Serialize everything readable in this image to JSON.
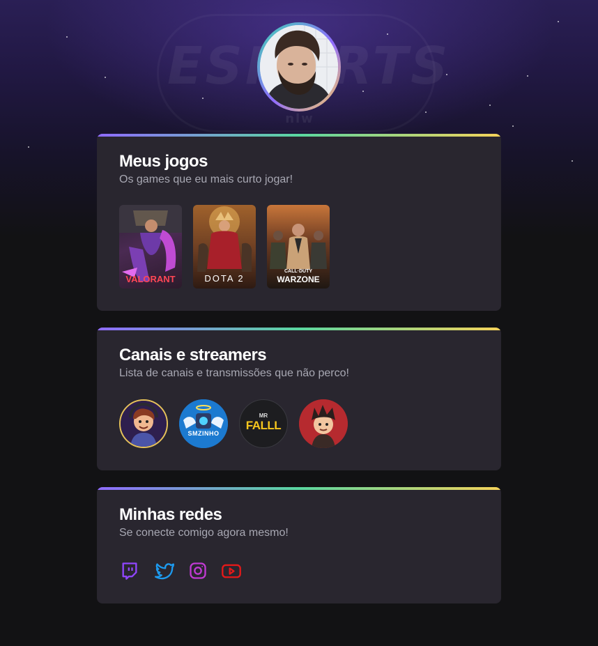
{
  "hero": {
    "watermark": "ESPORTS",
    "watermark_sub": "nlw"
  },
  "profile": {
    "avatar_icon": "user-avatar"
  },
  "games": {
    "title": "Meus jogos",
    "subtitle": "Os games que eu mais curto jogar!",
    "items": [
      {
        "label": "VALORANT"
      },
      {
        "label": "DOTA 2"
      },
      {
        "label_top": "CALL·DUTY",
        "label": "WARZONE"
      }
    ]
  },
  "channels": {
    "title": "Canais e streamers",
    "subtitle": "Lista de canais e transmissões que não perco!",
    "items": [
      {
        "label": ""
      },
      {
        "label": "SMZINHO"
      },
      {
        "label_top": "MR",
        "label": "FALLL"
      },
      {
        "label": ""
      }
    ]
  },
  "socials": {
    "title": "Minhas redes",
    "subtitle": "Se conecte comigo agora mesmo!",
    "items": [
      {
        "icon": "twitch-icon",
        "color": "#9146ff"
      },
      {
        "icon": "twitter-icon",
        "color": "#1d9bf0"
      },
      {
        "icon": "instagram-icon",
        "color": "#c13ad3"
      },
      {
        "icon": "youtube-icon",
        "color": "#e61919"
      }
    ]
  },
  "colors": {
    "background": "#121214",
    "card": "#29262f",
    "gradient": [
      "#8f6bff",
      "#5ad7a0",
      "#f6d35a"
    ]
  }
}
